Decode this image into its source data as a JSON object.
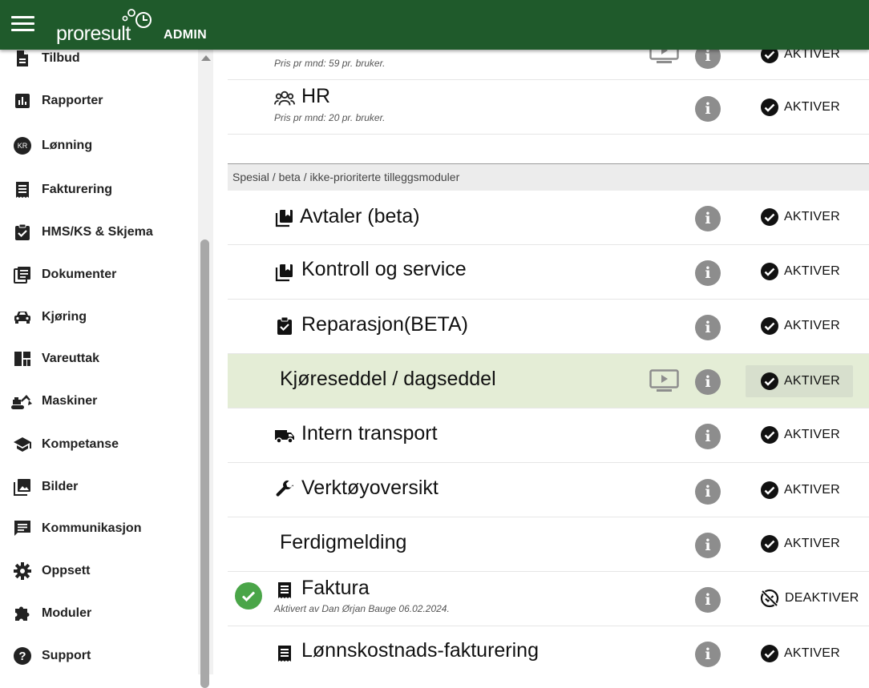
{
  "header": {
    "brand": "proresult",
    "role": "ADMIN"
  },
  "sidebar": {
    "items": [
      {
        "label": "Tilbud",
        "icon": "document-icon"
      },
      {
        "label": "Rapporter",
        "icon": "bar-chart-icon"
      },
      {
        "label": "Lønning",
        "icon": "kr-coin-icon",
        "icon_text": "KR"
      },
      {
        "label": "Fakturering",
        "icon": "receipt-icon"
      },
      {
        "label": "HMS/KS & Skjema",
        "icon": "clipboard-check-icon"
      },
      {
        "label": "Dokumenter",
        "icon": "documents-icon"
      },
      {
        "label": "Kjøring",
        "icon": "car-icon"
      },
      {
        "label": "Vareuttak",
        "icon": "grid-icon"
      },
      {
        "label": "Maskiner",
        "icon": "excavator-icon"
      },
      {
        "label": "Kompetanse",
        "icon": "graduation-cap-icon"
      },
      {
        "label": "Bilder",
        "icon": "images-icon"
      },
      {
        "label": "Kommunikasjon",
        "icon": "chat-icon"
      },
      {
        "label": "Oppsett",
        "icon": "gear-icon"
      },
      {
        "label": "Moduler",
        "icon": "puzzle-icon"
      },
      {
        "label": "Support",
        "icon": "help-circle-icon"
      }
    ]
  },
  "modules_top": [
    {
      "title": "",
      "subtitle": "Pris pr mnd: 59 pr. bruker.",
      "action": "AKTIVER",
      "has_video": true
    },
    {
      "title": "HR",
      "subtitle": "Pris pr mnd: 20 pr. bruker.",
      "action": "AKTIVER",
      "icon": "people-icon"
    }
  ],
  "section": {
    "title": "Spesial / beta / ikke-prioriterte tilleggsmoduler"
  },
  "modules": [
    {
      "title": "Avtaler (beta)",
      "icon": "library-icon",
      "action": "AKTIVER"
    },
    {
      "title": "Kontroll og service",
      "icon": "library-icon",
      "action": "AKTIVER"
    },
    {
      "title": "Reparasjon(BETA)",
      "icon": "clipboard-check-icon",
      "action": "AKTIVER"
    },
    {
      "title": "Kjøreseddel / dagseddel",
      "action": "AKTIVER",
      "has_video": true,
      "highlight": true
    },
    {
      "title": "Intern transport",
      "icon": "truck-icon",
      "action": "AKTIVER"
    },
    {
      "title": "Verktøyoversikt",
      "icon": "wrench-icon",
      "action": "AKTIVER"
    },
    {
      "title": "Ferdigmelding",
      "action": "AKTIVER"
    },
    {
      "title": "Faktura",
      "icon": "receipt-icon",
      "subtitle": "Aktivert av Dan Ørjan Bauge 06.02.2024.",
      "action": "DEAKTIVER",
      "active": true
    },
    {
      "title": "Lønnskostnads-fakturering",
      "icon": "receipt-icon",
      "action": "AKTIVER"
    }
  ],
  "info_glyph": "i",
  "colors": {
    "topbar": "#1f5a2b",
    "highlight_row": "#e4edd6",
    "active_check": "#4aa548",
    "info_button": "#8d8d8d"
  }
}
